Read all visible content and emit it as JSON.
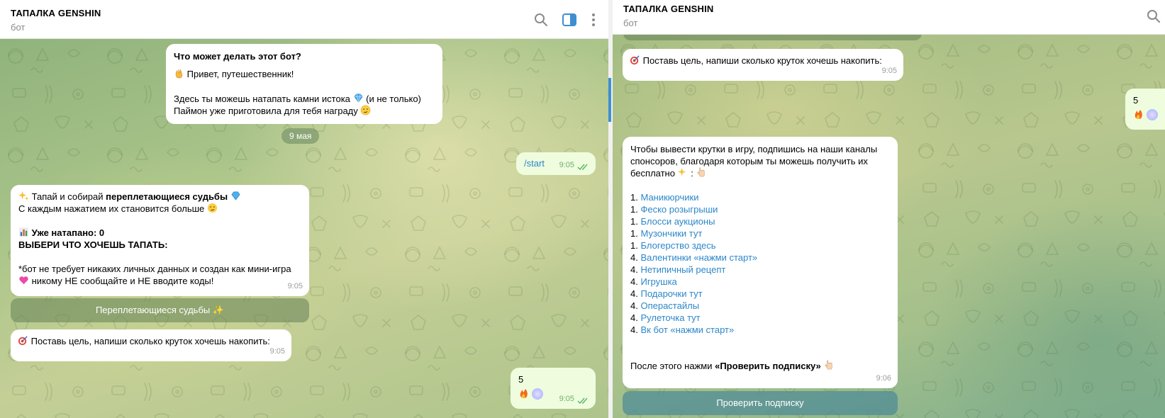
{
  "header": {
    "title": "ТАПАЛКА GENSHIN",
    "subtitle": "бот"
  },
  "left": {
    "about": {
      "title": "Что может делать этот бот?",
      "line1": "Привет, путешественник!",
      "line2a": "Здесь ты можешь натапать камни истока",
      "line2b": "(и не только)",
      "line3": "Паймон уже приготовила для тебя награду"
    },
    "date": "9 мая",
    "start": {
      "text": "/start",
      "time": "9:05"
    },
    "tap_msg": {
      "l1a": "Тапай и собирай ",
      "l1b": "переплетающиеся судьбы",
      "l2": "С каждым нажатием их становится больше",
      "l3": "Уже натапано: 0",
      "l4": "ВЫБЕРИ ЧТО ХОЧЕШЬ ТАПАТЬ:",
      "l5": "*бот не требует никаких личных данных и создан как мини-игра",
      "l6": "никому НЕ сообщайте и НЕ вводите коды!",
      "time": "9:05"
    },
    "button": "Переплетающиеся судьбы ✨",
    "goal": {
      "text": "Поставь цель, напиши сколько круток хочешь накопить:",
      "time": "9:05"
    },
    "reply": {
      "text": "5",
      "time": "9:05"
    }
  },
  "right": {
    "goal": {
      "text": "Поставь цель, напиши сколько круток хочешь накопить:",
      "time": "9:05"
    },
    "reply": {
      "text": "5"
    },
    "sponsors": {
      "l1": "Чтобы вывести крутки в игру, подпишись на наши каналы",
      "l2": "спонсоров, благодаря которым ты можешь получить их",
      "l3": "бесплатно",
      "items": [
        {
          "num": "1.",
          "label": "Маникюрчики"
        },
        {
          "num": "1.",
          "label": "Феско розыгрыши"
        },
        {
          "num": "1.",
          "label": "Блосси аукционы"
        },
        {
          "num": "1.",
          "label": "Музончики тут"
        },
        {
          "num": "1.",
          "label": "Блогерство здесь"
        },
        {
          "num": "4.",
          "label": "Валентинки «нажми старт»"
        },
        {
          "num": "4.",
          "label": "Нетипичный рецепт"
        },
        {
          "num": "4.",
          "label": "Игрушка"
        },
        {
          "num": "4.",
          "label": "Подарочки тут"
        },
        {
          "num": "4.",
          "label": "Операстайлы"
        },
        {
          "num": "4.",
          "label": "Рулеточка тут"
        },
        {
          "num": "4.",
          "label": "Вк бот «нажми старт»"
        }
      ],
      "after_a": "После этого нажми ",
      "after_b": "«Проверить подписку»",
      "time": "9:06"
    },
    "button": "Проверить подписку"
  },
  "icons": [
    "search-icon",
    "sidebar-toggle-icon",
    "more-vertical-icon",
    "wave-emoji-icon",
    "gem-icon",
    "smirk-emoji-icon",
    "sparkles-icon",
    "chart-icon",
    "heart-icon",
    "target-icon",
    "fire-icon",
    "pointing-down-icon",
    "double-check-icon"
  ],
  "colors": {
    "accent": "#3e8fd0",
    "link": "#2c87c9",
    "outgoing": "#effdde"
  }
}
